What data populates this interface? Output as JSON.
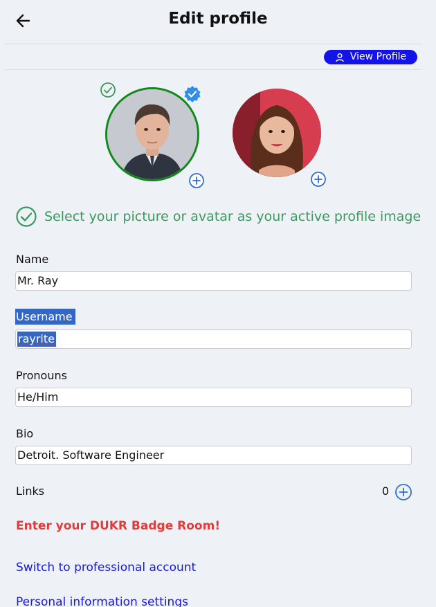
{
  "header": {
    "title": "Edit profile",
    "back_icon": "arrow-left-icon"
  },
  "view_profile": {
    "label": "View Profile",
    "icon": "user-icon"
  },
  "avatars": [
    {
      "name": "profile-picture",
      "active": true,
      "verified": true,
      "ring_color": "#0f8a1a"
    },
    {
      "name": "avatar-picture",
      "active": false
    }
  ],
  "select_message": "Select your picture or avatar as your active profile image",
  "fields": {
    "name": {
      "label": "Name",
      "value": "Mr. Ray"
    },
    "username": {
      "label": "Username",
      "value": "rayrite"
    },
    "pronouns": {
      "label": "Pronouns",
      "value": "He/Him"
    },
    "bio": {
      "label": "Bio",
      "value": "Detroit. Software Engineer"
    }
  },
  "links": {
    "label": "Links",
    "count": "0"
  },
  "badge_room_link": "Enter your DUKR Badge Room!",
  "professional_link": "Switch to professional account",
  "personal_settings_link": "Personal information settings",
  "colors": {
    "accent_blue": "#1414e6",
    "success_green": "#3a9a5c",
    "link_red": "#e03c3c",
    "link_blue": "#1a1ad6",
    "selection": "#3367c7"
  }
}
